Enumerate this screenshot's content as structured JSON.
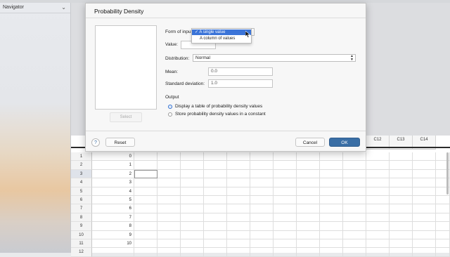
{
  "navigator": {
    "title": "Navigator"
  },
  "dialog": {
    "title": "Probability Density",
    "form_of_input_label": "Form of input",
    "form_options": [
      "A single value",
      "A column of values"
    ],
    "form_selected_index": 0,
    "value_label": "Value:",
    "value": "",
    "distribution_label": "Distribution:",
    "distribution_value": "Normal",
    "mean_label": "Mean:",
    "mean_value": "0.0",
    "sd_label": "Standard deviation:",
    "sd_value": "1.0",
    "output_label": "Output",
    "output_options": [
      {
        "label": "Display a table of probability density values",
        "selected": true
      },
      {
        "label": "Store probability density values in a constant",
        "selected": false
      }
    ],
    "select_button": "Select",
    "help_button": "?",
    "reset_button": "Reset",
    "cancel_button": "Cancel",
    "ok_button": "OK"
  },
  "worksheet": {
    "visible_columns": [
      "C12",
      "C13",
      "C14"
    ],
    "rows": [
      {
        "row": "1",
        "value": "0"
      },
      {
        "row": "2",
        "value": "1"
      },
      {
        "row": "3",
        "value": "2"
      },
      {
        "row": "4",
        "value": "3"
      },
      {
        "row": "5",
        "value": "4"
      },
      {
        "row": "6",
        "value": "5"
      },
      {
        "row": "7",
        "value": "6"
      },
      {
        "row": "8",
        "value": "7"
      },
      {
        "row": "9",
        "value": "8"
      },
      {
        "row": "10",
        "value": "9"
      },
      {
        "row": "11",
        "value": "10"
      },
      {
        "row": "12",
        "value": ""
      }
    ],
    "selected_row": "3"
  },
  "colors": {
    "primary_button": "#3a6ea5",
    "selection": "#3b74d8"
  }
}
